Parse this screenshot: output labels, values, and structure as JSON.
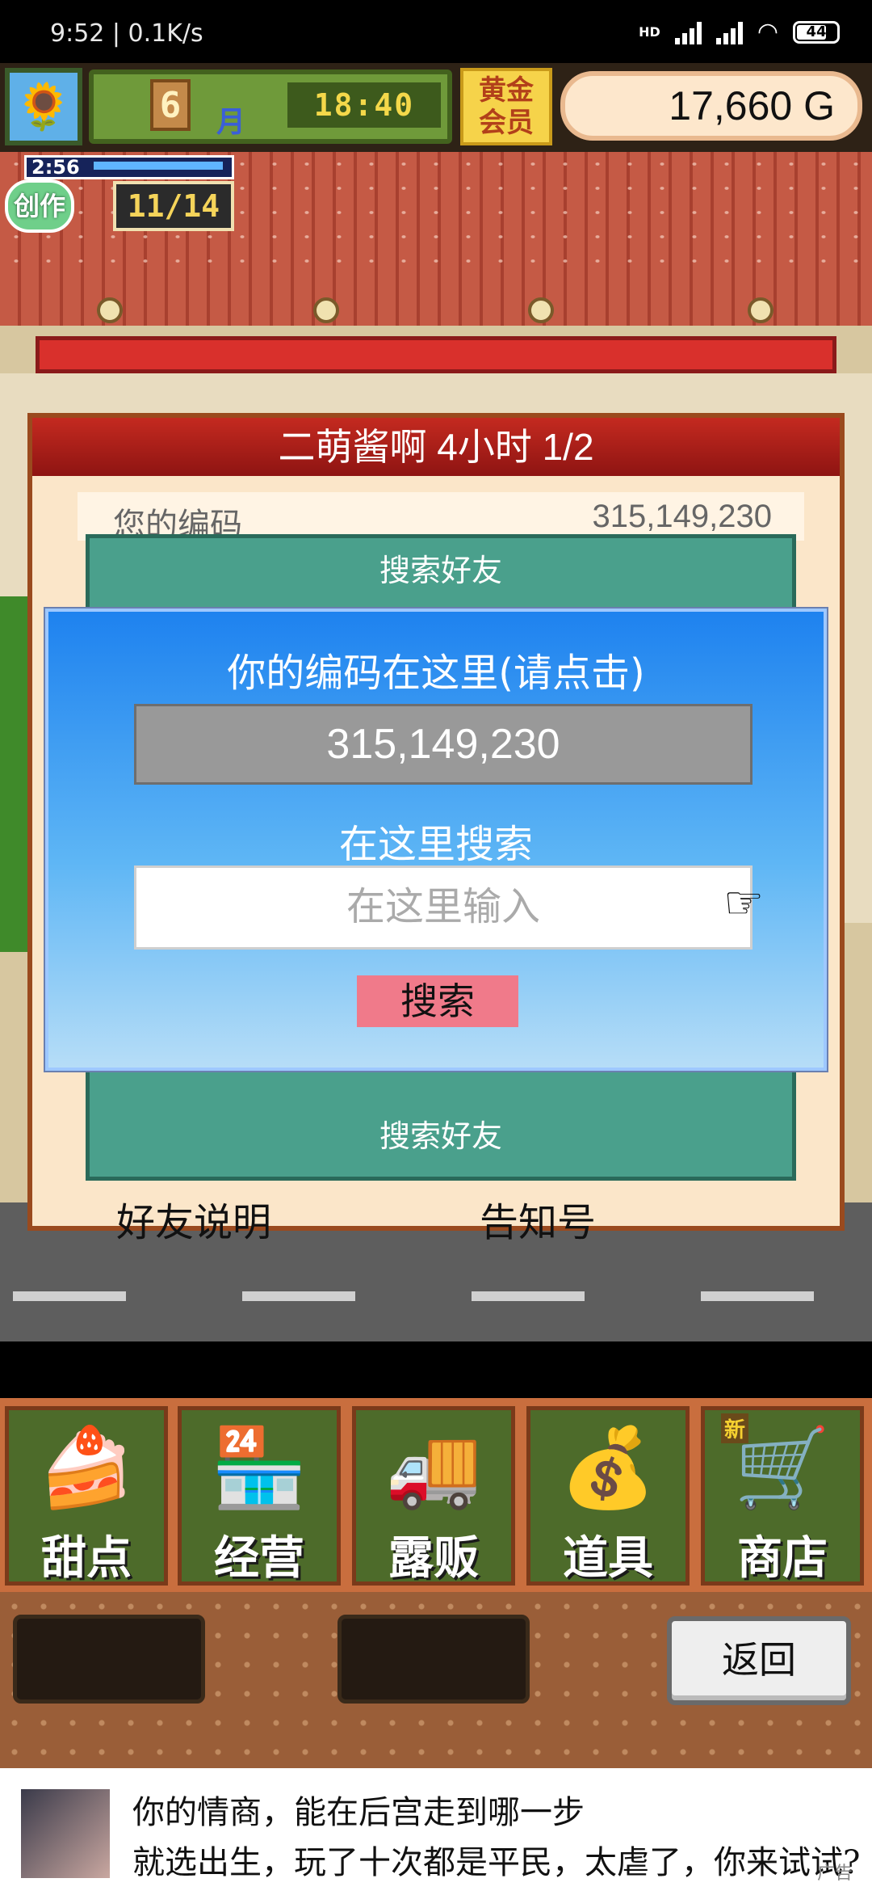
{
  "status_bar": {
    "time_speed": "9:52 | 0.1K/s",
    "network": "HD",
    "battery": "44"
  },
  "hud": {
    "month_number": "6",
    "month_label": "月",
    "clock": "18:40",
    "gold_badge_line1": "黄金",
    "gold_badge_line2": "会员",
    "money": "17,660 G"
  },
  "creation": {
    "timer": "2:56",
    "label": "创作",
    "count": "11/14"
  },
  "friend_panel": {
    "title": "二萌酱啊  4小时 1/2",
    "code_label": "您的编码",
    "code_value": "315,149,230",
    "teal_top_text": "搜索好友",
    "teal_bottom_text": "搜索好友",
    "footer_left": "好友说明",
    "footer_right": "告知号"
  },
  "search_dialog": {
    "title": "你的编码在这里(请点击)",
    "code_value": "315,149,230",
    "search_label": "在这里搜索",
    "input_placeholder": "在这里输入",
    "search_button": "搜索"
  },
  "menu": {
    "items": [
      {
        "label": "甜点",
        "icon": "cake-icon"
      },
      {
        "label": "经营",
        "icon": "shop-icon"
      },
      {
        "label": "露贩",
        "icon": "food-truck-icon"
      },
      {
        "label": "道具",
        "icon": "item-bag-icon"
      },
      {
        "label": "商店",
        "icon": "cart-icon",
        "badge": "新"
      }
    ],
    "back_button": "返回"
  },
  "ad": {
    "line1": "你的情商，能在后宫走到哪一步",
    "line2": "就选出生，玩了十次都是平民，太虐了，你来试试?",
    "tag": "广告"
  }
}
